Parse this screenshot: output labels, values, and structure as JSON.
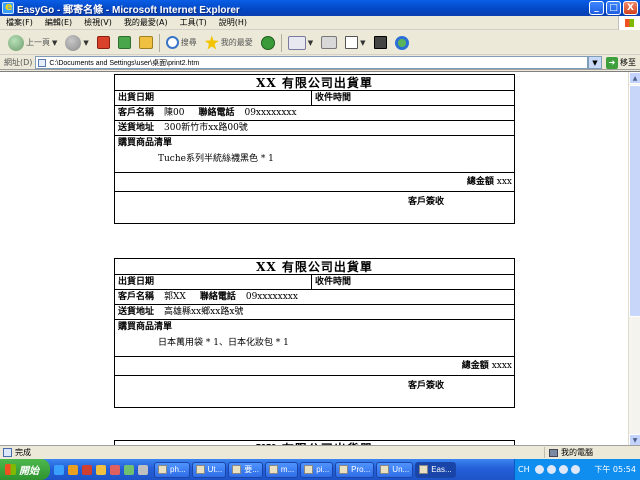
{
  "window": {
    "title": "EasyGo - 郵寄名條 - Microsoft Internet Explorer",
    "buttons": {
      "minimize": "_",
      "maximize": "□",
      "close": "X"
    }
  },
  "menu": {
    "items": [
      "檔案(F)",
      "編輯(E)",
      "檢視(V)",
      "我的最愛(A)",
      "工具(T)",
      "說明(H)"
    ]
  },
  "toolbar": {
    "back_label": "上一頁",
    "search_label": "搜尋",
    "favorites_label": "我的最愛"
  },
  "address": {
    "label": "網址(D)",
    "url": "C:\\Documents and Settings\\user\\桌面\\print2.htm",
    "go_label": "移至"
  },
  "invoices": [
    {
      "title": "XX 有限公司出貨單",
      "ship_date_label": "出貨日期",
      "receive_time_label": "收件時間",
      "customer_label": "客戶名稱",
      "customer_name": "陳00",
      "phone_label": "聯絡電話",
      "phone": "09xxxxxxxx",
      "address_label": "送貨地址",
      "address": "300新竹市xx路00號",
      "goods_label": "購買商品清單",
      "goods": "Tuche系列半統絲襪黑色 * 1",
      "total_label": "總金額",
      "total": "xxx",
      "sign_label": "客戶簽收"
    },
    {
      "title": "XX 有限公司出貨單",
      "ship_date_label": "出貨日期",
      "receive_time_label": "收件時間",
      "customer_label": "客戶名稱",
      "customer_name": "郭XX",
      "phone_label": "聯絡電話",
      "phone": "09xxxxxxxx",
      "address_label": "送貨地址",
      "address": "高雄縣xx鄉xx路x號",
      "goods_label": "購買商品清單",
      "goods": "日本萬用袋 * 1、日本化妝包 * 1",
      "total_label": "總金額",
      "total": "xxxx",
      "sign_label": "客戶簽收"
    }
  ],
  "status": {
    "text": "完成",
    "zone": "我的電腦"
  },
  "taskbar": {
    "start_label": "開始",
    "tasks": [
      "ph...",
      "Ut...",
      "要...",
      "m...",
      "pi...",
      "Pro...",
      "Un...",
      "Eas..."
    ],
    "language": "CH",
    "clock": "下午 05:54"
  }
}
